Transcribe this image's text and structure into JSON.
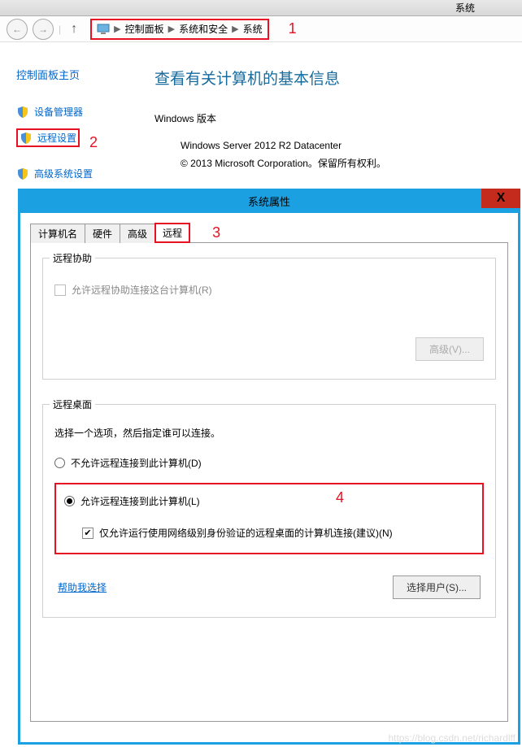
{
  "window": {
    "title": "系统"
  },
  "breadcrumb": {
    "home": "控制面板",
    "mid": "系统和安全",
    "leaf": "系统"
  },
  "annotations": {
    "n1": "1",
    "n2": "2",
    "n3": "3",
    "n4": "4"
  },
  "sidebar": {
    "title": "控制面板主页",
    "items": [
      "设备管理器",
      "远程设置",
      "高级系统设置"
    ]
  },
  "content": {
    "title": "查看有关计算机的基本信息",
    "section": "Windows 版本",
    "version": "Windows Server 2012 R2 Datacenter",
    "copyright": "© 2013 Microsoft Corporation。保留所有权利。"
  },
  "dialog": {
    "title": "系统属性",
    "close": "X",
    "tabs": [
      "计算机名",
      "硬件",
      "高级",
      "远程"
    ],
    "remote_assist": {
      "legend": "远程协助",
      "checkbox": "允许远程协助连接这台计算机(R)",
      "advanced_btn": "高级(V)..."
    },
    "remote_desktop": {
      "legend": "远程桌面",
      "intro": "选择一个选项，然后指定谁可以连接。",
      "opt_deny": "不允许远程连接到此计算机(D)",
      "opt_allow": "允许远程连接到此计算机(L)",
      "nla": "仅允许运行使用网络级别身份验证的远程桌面的计算机连接(建议)(N)",
      "help": "帮助我选择",
      "select_users": "选择用户(S)..."
    }
  },
  "watermark": "https://blog.csdn.net/richardlff"
}
